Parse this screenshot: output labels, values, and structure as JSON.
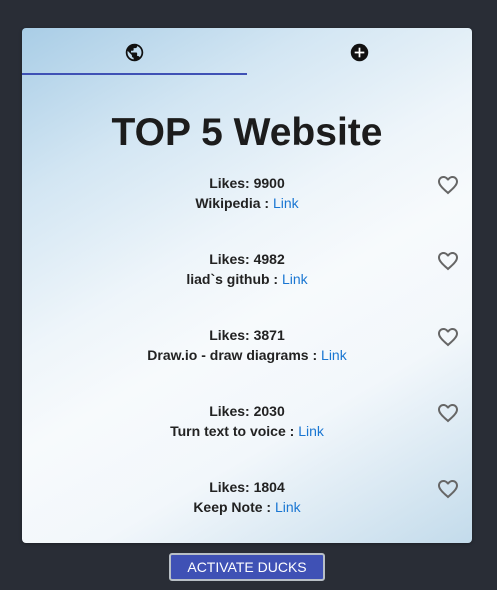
{
  "tabs": [
    {
      "icon": "globe-icon"
    },
    {
      "icon": "plus-circle-icon"
    }
  ],
  "page_title": "TOP 5 Website",
  "likes_prefix": "Likes: ",
  "link_label": "Link",
  "sites": [
    {
      "likes": "9900",
      "name": "Wikipedia : "
    },
    {
      "likes": "4982",
      "name": "liad`s github : "
    },
    {
      "likes": "3871",
      "name": "Draw.io - draw diagrams : "
    },
    {
      "likes": "2030",
      "name": "Turn text to voice : "
    },
    {
      "likes": "1804",
      "name": "Keep Note : "
    }
  ],
  "activate_button": "ACTIVATE DUCKS",
  "colors": {
    "background": "#292d36",
    "accent": "#3f51b5",
    "link": "#1976d2"
  }
}
